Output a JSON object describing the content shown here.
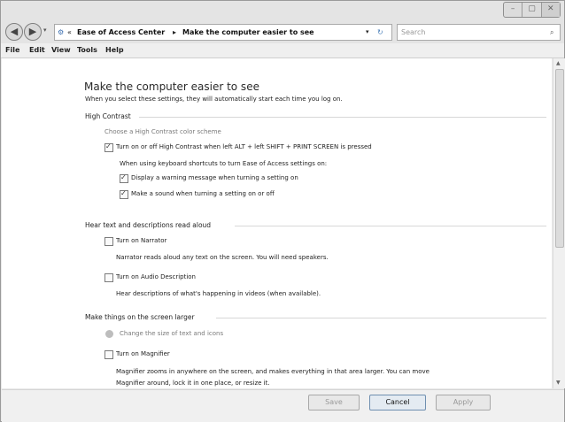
{
  "window": {
    "titlebar_controls": [
      "minimize",
      "maximize",
      "close"
    ]
  },
  "navigation": {
    "back": "back-button",
    "forward": "forward-button",
    "breadcrumb_prefix": "«",
    "breadcrumb_1": "Ease of Access Center",
    "breadcrumb_sep": "▸",
    "breadcrumb_2": "Make the computer easier to see",
    "refresh": "↻",
    "search_placeholder": "Search"
  },
  "menu": {
    "file": "File",
    "edit": "Edit",
    "view": "View",
    "tools": "Tools",
    "help": "Help"
  },
  "page": {
    "title": "Make the computer easier to see",
    "subtitle": "When you select these settings, they will automatically start each time you log on."
  },
  "high_contrast": {
    "section": "High Contrast",
    "choose_link": "Choose a High Contrast color scheme",
    "toggle_label": "Turn on or off High Contrast when left ALT + left SHIFT + PRINT SCREEN is pressed",
    "shortcut_heading": "When using keyboard shortcuts to turn Ease of Access settings on:",
    "warning_label": "Display a warning message when turning a setting on",
    "sound_label": "Make a sound when turning a setting on or off"
  },
  "narration": {
    "section": "Hear text and descriptions read aloud",
    "narrator_label": "Turn on Narrator",
    "narrator_desc": "Narrator reads aloud any text on the screen. You will need speakers.",
    "audio_desc_label": "Turn on Audio Description",
    "audio_desc_desc": "Hear descriptions of what's happening in videos (when available)."
  },
  "larger": {
    "section": "Make things on the screen larger",
    "change_size_link": "Change the size of text and icons",
    "magnifier_label": "Turn on Magnifier",
    "magnifier_desc_1": "Magnifier zooms in anywhere on the screen, and makes everything in that area larger. You can move",
    "magnifier_desc_2": "Magnifier around, lock it in one place, or resize it."
  },
  "footer": {
    "save": "Save",
    "cancel": "Cancel",
    "apply": "Apply"
  },
  "states": {
    "high_contrast_toggle": true,
    "warning": true,
    "sound": true,
    "narrator": false,
    "audio_desc": false,
    "magnifier": false
  }
}
